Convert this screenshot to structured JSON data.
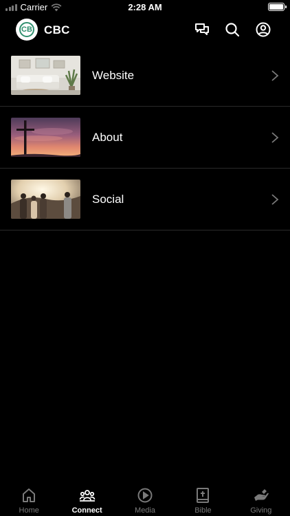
{
  "status_bar": {
    "carrier": "Carrier",
    "time": "2:28 AM"
  },
  "header": {
    "title": "CBC",
    "logo_letters": "CB"
  },
  "list": [
    {
      "label": "Website",
      "icon": "living-room-photo"
    },
    {
      "label": "About",
      "icon": "cross-sunset-photo"
    },
    {
      "label": "Social",
      "icon": "group-people-photo"
    }
  ],
  "tabs": [
    {
      "label": "Home",
      "icon": "home-icon",
      "active": false
    },
    {
      "label": "Connect",
      "icon": "people-icon",
      "active": true
    },
    {
      "label": "Media",
      "icon": "play-icon",
      "active": false
    },
    {
      "label": "Bible",
      "icon": "bible-icon",
      "active": false
    },
    {
      "label": "Giving",
      "icon": "giving-hand-icon",
      "active": false
    }
  ],
  "colors": {
    "background": "#000000",
    "active_tab": "#ffffff",
    "inactive_tab": "#7a7a7a",
    "logo_green": "#2f8f6e"
  }
}
